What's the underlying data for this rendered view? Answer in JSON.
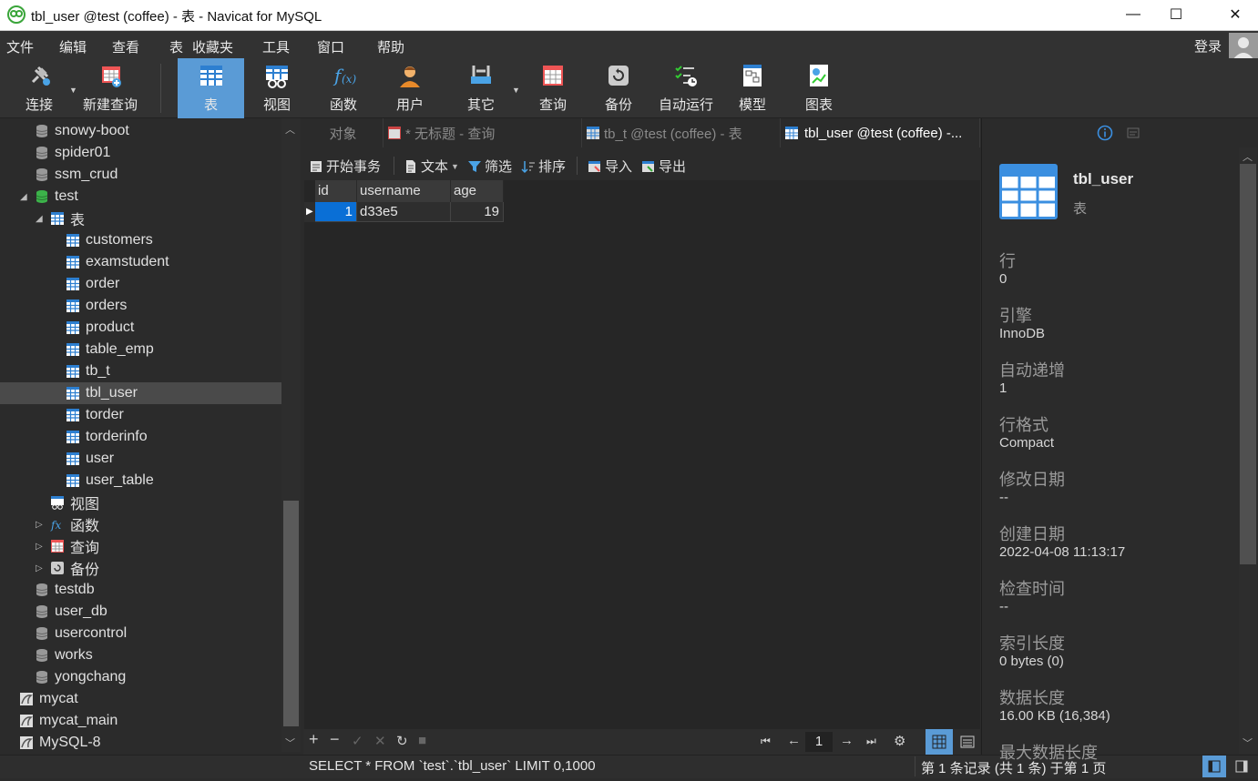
{
  "window": {
    "title": "tbl_user @test (coffee) - 表 - Navicat for MySQL",
    "minimize": "—",
    "maximize": "☐",
    "close": "✕"
  },
  "menu": [
    "文件",
    "编辑",
    "查看",
    "表",
    "收藏夹",
    "工具",
    "窗口",
    "帮助"
  ],
  "login": "登录",
  "toolbar": [
    {
      "label": "连接",
      "icon": "plug-icon"
    },
    {
      "label": "新建查询",
      "icon": "new-query-icon"
    },
    {
      "label": "表",
      "icon": "table-icon"
    },
    {
      "label": "视图",
      "icon": "view-icon"
    },
    {
      "label": "函数",
      "icon": "function-icon"
    },
    {
      "label": "用户",
      "icon": "user-icon"
    },
    {
      "label": "其它",
      "icon": "tools-icon"
    },
    {
      "label": "查询",
      "icon": "query-icon"
    },
    {
      "label": "备份",
      "icon": "backup-icon"
    },
    {
      "label": "自动运行",
      "icon": "schedule-icon"
    },
    {
      "label": "模型",
      "icon": "model-icon"
    },
    {
      "label": "图表",
      "icon": "chart-icon"
    }
  ],
  "tree": [
    {
      "label": "snowy-boot",
      "kind": "db"
    },
    {
      "label": "spider01",
      "kind": "db"
    },
    {
      "label": "ssm_crud",
      "kind": "db"
    },
    {
      "label": "test",
      "kind": "db-open"
    },
    {
      "label": "表",
      "kind": "tables-folder"
    },
    {
      "label": "customers",
      "kind": "table"
    },
    {
      "label": "examstudent",
      "kind": "table"
    },
    {
      "label": "order",
      "kind": "table"
    },
    {
      "label": "orders",
      "kind": "table"
    },
    {
      "label": "product",
      "kind": "table"
    },
    {
      "label": "table_emp",
      "kind": "table"
    },
    {
      "label": "tb_t",
      "kind": "table"
    },
    {
      "label": "tbl_user",
      "kind": "table"
    },
    {
      "label": "torder",
      "kind": "table"
    },
    {
      "label": "torderinfo",
      "kind": "table"
    },
    {
      "label": "user",
      "kind": "table"
    },
    {
      "label": "user_table",
      "kind": "table"
    },
    {
      "label": "视图",
      "kind": "views"
    },
    {
      "label": "函数",
      "kind": "functions"
    },
    {
      "label": "查询",
      "kind": "queries"
    },
    {
      "label": "备份",
      "kind": "backups"
    },
    {
      "label": "testdb",
      "kind": "db"
    },
    {
      "label": "user_db",
      "kind": "db"
    },
    {
      "label": "usercontrol",
      "kind": "db"
    },
    {
      "label": "works",
      "kind": "db"
    },
    {
      "label": "yongchang",
      "kind": "db"
    },
    {
      "label": "mycat",
      "kind": "conn"
    },
    {
      "label": "mycat_main",
      "kind": "conn"
    },
    {
      "label": "MySQL-8",
      "kind": "conn"
    }
  ],
  "tabs": [
    "对象",
    "* 无标题 - 查询",
    "tb_t @test (coffee) - 表",
    "tbl_user @test (coffee) -..."
  ],
  "subtoolbar": [
    "开始事务",
    "文本",
    "筛选",
    "排序",
    "导入",
    "导出"
  ],
  "grid": {
    "columns": [
      "id",
      "username",
      "age"
    ],
    "rows": [
      [
        "1",
        "d33e5",
        "19"
      ]
    ]
  },
  "pager": {
    "page": "1"
  },
  "status": {
    "sql": "SELECT * FROM `test`.`tbl_user` LIMIT 0,1000",
    "records": "第 1 条记录 (共 1 条) 于第 1 页"
  },
  "info": {
    "name": "tbl_user",
    "type": "表",
    "props": [
      {
        "k": "行",
        "v": "0"
      },
      {
        "k": "引擎",
        "v": "InnoDB"
      },
      {
        "k": "自动递增",
        "v": "1"
      },
      {
        "k": "行格式",
        "v": "Compact"
      },
      {
        "k": "修改日期",
        "v": "--"
      },
      {
        "k": "创建日期",
        "v": "2022-04-08 11:13:17"
      },
      {
        "k": "检查时间",
        "v": "--"
      },
      {
        "k": "索引长度",
        "v": "0 bytes (0)"
      },
      {
        "k": "数据长度",
        "v": "16.00 KB (16,384)"
      },
      {
        "k": "最大数据长度",
        "v": ""
      }
    ]
  }
}
